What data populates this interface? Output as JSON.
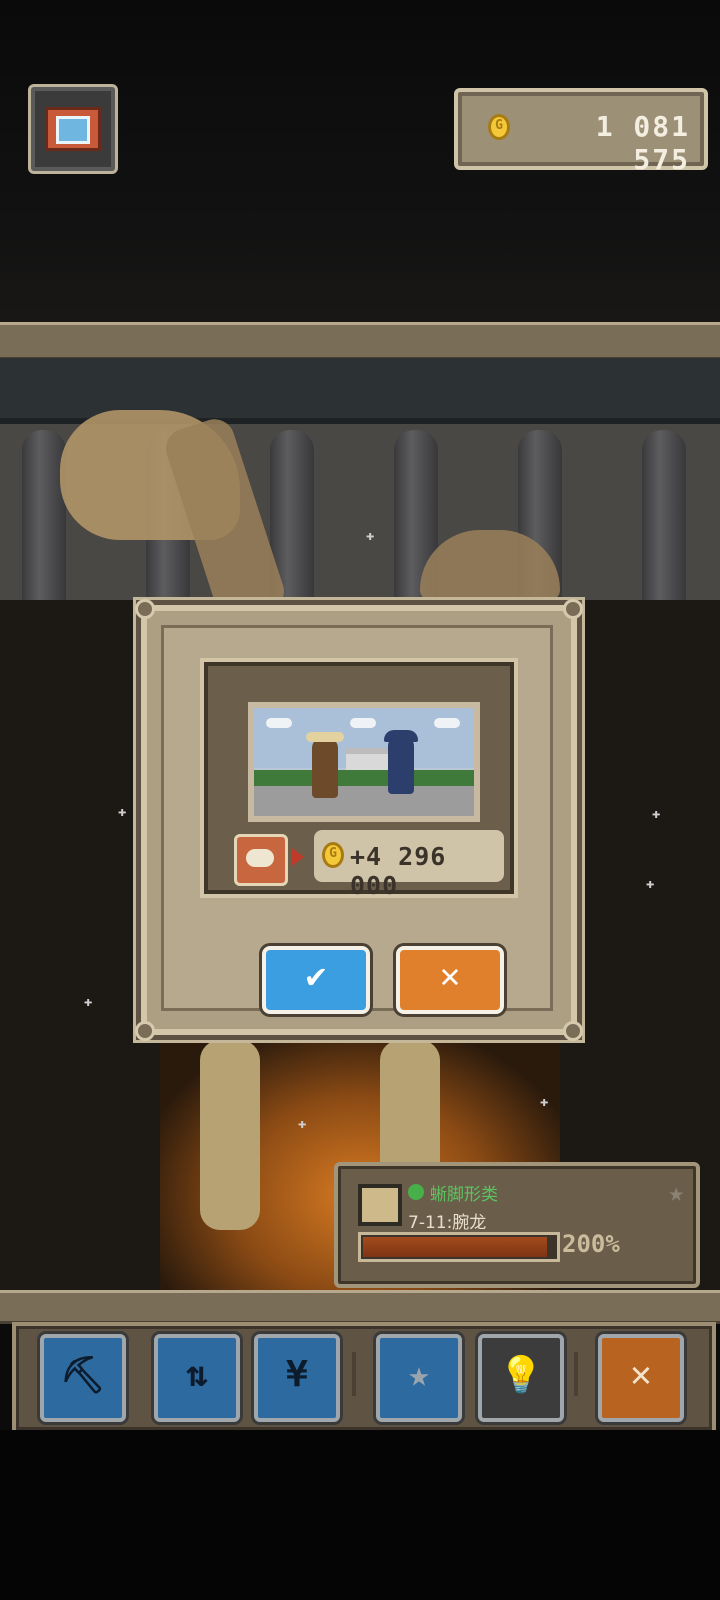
{
  "hud": {
    "camera_icon": "camera-icon",
    "coins": "1 081 575",
    "coin_icon": "gold-coin-icon"
  },
  "dialog": {
    "scene_icon": "museum-sale-scene",
    "fossil_icon": "fossil-bone-icon",
    "arrow_icon": "red-arrow-icon",
    "reward_amount": "+4 296 000",
    "confirm_glyph": "✔",
    "cancel_glyph": "✕"
  },
  "exhibit": {
    "category": "蜥脚形类",
    "level": "7-11:腕龙",
    "progress_label": "200%",
    "progress_fraction": 0.96,
    "star_icon": "star-icon"
  },
  "toolbar": {
    "items": [
      {
        "icon": "pickaxe-icon",
        "glyph": "⛏"
      },
      {
        "icon": "swap-icon",
        "glyph": "⇅"
      },
      {
        "icon": "money-bag-icon",
        "glyph": "¥"
      },
      {
        "icon": "star-icon",
        "glyph": "★"
      },
      {
        "icon": "lightbulb-icon",
        "glyph": "💡"
      },
      {
        "icon": "close-icon",
        "glyph": "✕"
      }
    ]
  },
  "colors": {
    "confirm": "#3b9ee0",
    "cancel": "#e07f2c",
    "category_green": "#5cc45f"
  }
}
